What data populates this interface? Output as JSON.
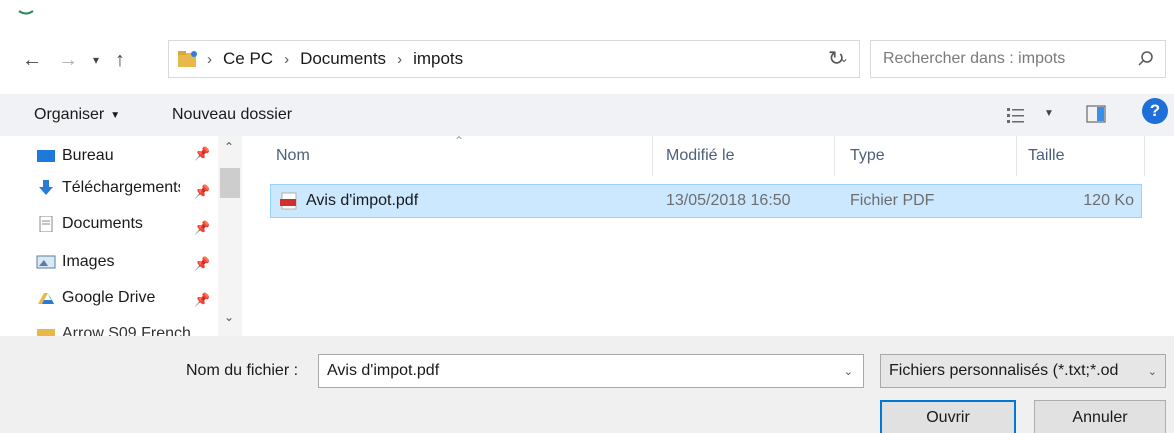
{
  "address": {
    "crumbs": [
      "Ce PC",
      "Documents",
      "impots"
    ]
  },
  "search": {
    "placeholder": "Rechercher dans : impots"
  },
  "toolbar": {
    "organize_label": "Organiser",
    "new_folder_label": "Nouveau dossier"
  },
  "nav": {
    "items": [
      {
        "label": "Bureau"
      },
      {
        "label": "Téléchargements"
      },
      {
        "label": "Documents"
      },
      {
        "label": "Images"
      },
      {
        "label": "Google Drive"
      },
      {
        "label": "Arrow S09 French"
      }
    ]
  },
  "columns": {
    "name": "Nom",
    "modified": "Modifié le",
    "type": "Type",
    "size": "Taille"
  },
  "files": [
    {
      "name": "Avis d'impot.pdf",
      "modified": "13/05/2018 16:50",
      "type": "Fichier PDF",
      "size": "120 Ko"
    }
  ],
  "footer": {
    "filename_label": "Nom du fichier :",
    "filename_value": "Avis d'impot.pdf",
    "filter_label": "Fichiers personnalisés (*.txt;*.od",
    "open_label": "Ouvrir",
    "cancel_label": "Annuler"
  },
  "colors": {
    "selection": "#cce8ff",
    "selection_border": "#99d1ff",
    "accent": "#0078d7",
    "help": "#1e6fd9"
  }
}
